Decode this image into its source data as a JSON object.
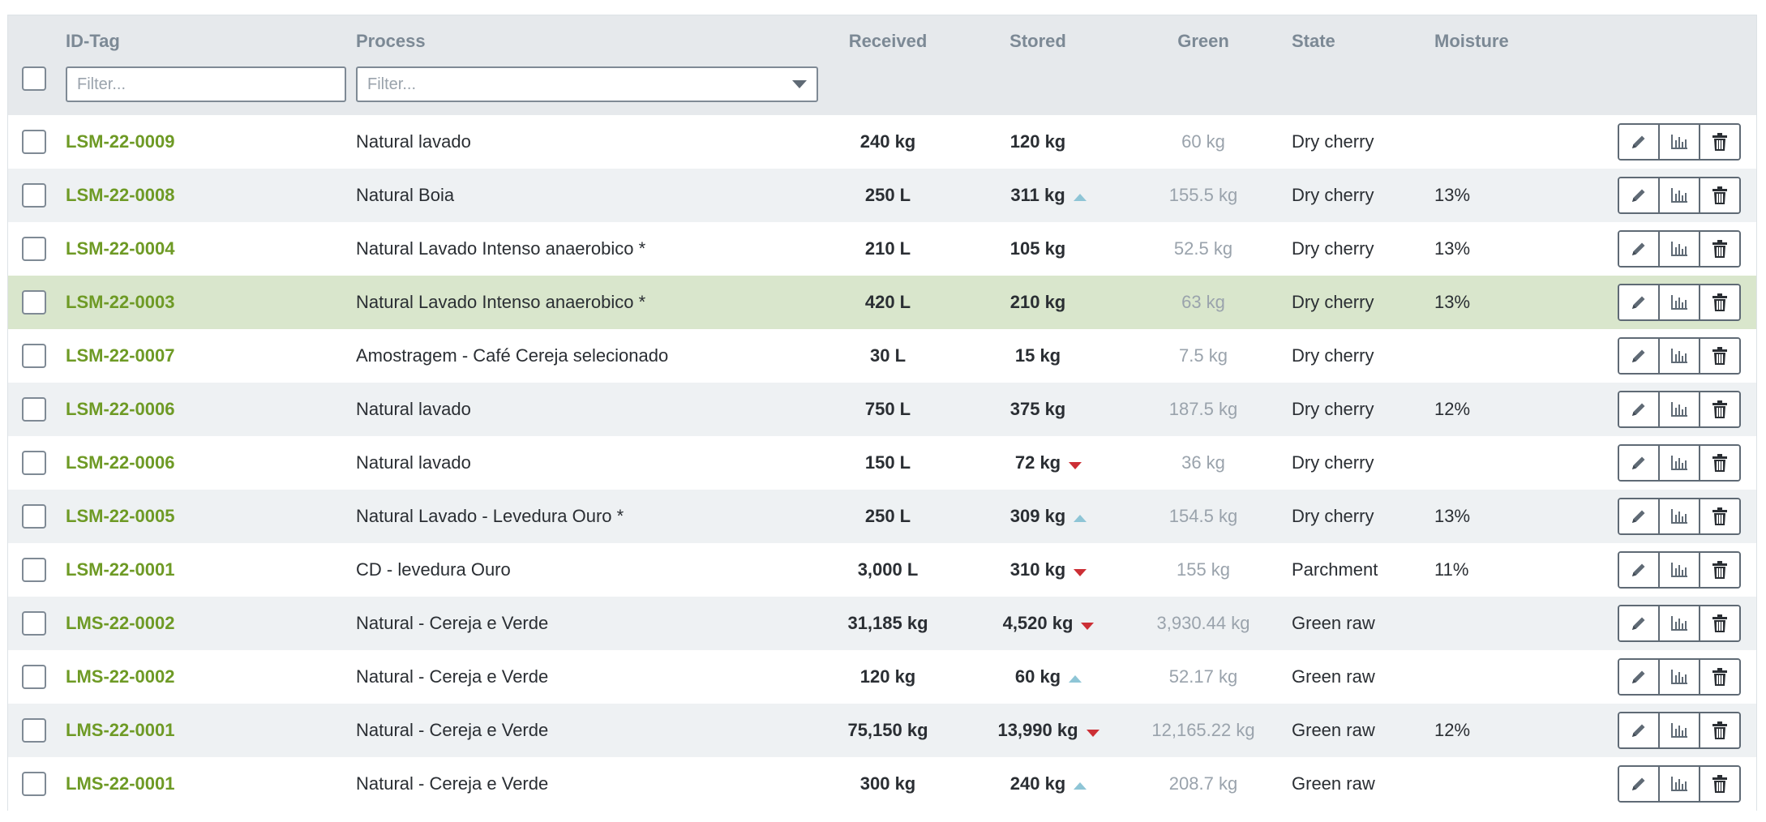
{
  "header": {
    "id_tag": "ID-Tag",
    "process": "Process",
    "received": "Received",
    "stored": "Stored",
    "green": "Green",
    "state": "State",
    "moisture": "Moisture",
    "id_filter_placeholder": "Filter...",
    "process_filter_placeholder": "Filter..."
  },
  "colors": {
    "id_green": "#6e9a25",
    "header_bg": "#e6e9ec",
    "row_alt_bg": "#eef1f3",
    "row_selected_bg": "#d9e6cc",
    "trend_up": "#8ec5d6",
    "trend_down": "#cc2f35",
    "muted_text": "#9aa3ac"
  },
  "icons": {
    "edit": "pencil-icon",
    "chart": "bar-chart-icon",
    "delete": "trash-icon",
    "trend_up": "triangle-up-icon",
    "trend_down": "triangle-down-icon",
    "dropdown": "chevron-down-icon"
  },
  "rows": [
    {
      "id": "LSM-22-0009",
      "process": "Natural lavado",
      "received": "240 kg",
      "stored": "120 kg",
      "trend": "",
      "green": "60 kg",
      "state": "Dry cherry",
      "moisture": "",
      "selected": false
    },
    {
      "id": "LSM-22-0008",
      "process": "Natural Boia",
      "received": "250 L",
      "stored": "311 kg",
      "trend": "up",
      "green": "155.5 kg",
      "state": "Dry cherry",
      "moisture": "13%",
      "selected": false
    },
    {
      "id": "LSM-22-0004",
      "process": "Natural Lavado Intenso anaerobico *",
      "received": "210 L",
      "stored": "105 kg",
      "trend": "",
      "green": "52.5 kg",
      "state": "Dry cherry",
      "moisture": "13%",
      "selected": false
    },
    {
      "id": "LSM-22-0003",
      "process": "Natural Lavado Intenso anaerobico *",
      "received": "420 L",
      "stored": "210 kg",
      "trend": "",
      "green": "63 kg",
      "state": "Dry cherry",
      "moisture": "13%",
      "selected": true
    },
    {
      "id": "LSM-22-0007",
      "process": "Amostragem - Café Cereja selecionado",
      "received": "30 L",
      "stored": "15 kg",
      "trend": "",
      "green": "7.5 kg",
      "state": "Dry cherry",
      "moisture": "",
      "selected": false
    },
    {
      "id": "LSM-22-0006",
      "process": "Natural lavado",
      "received": "750 L",
      "stored": "375 kg",
      "trend": "",
      "green": "187.5 kg",
      "state": "Dry cherry",
      "moisture": "12%",
      "selected": false
    },
    {
      "id": "LSM-22-0006",
      "process": "Natural lavado",
      "received": "150 L",
      "stored": "72 kg",
      "trend": "down",
      "green": "36 kg",
      "state": "Dry cherry",
      "moisture": "",
      "selected": false
    },
    {
      "id": "LSM-22-0005",
      "process": "Natural Lavado - Levedura Ouro *",
      "received": "250 L",
      "stored": "309 kg",
      "trend": "up",
      "green": "154.5 kg",
      "state": "Dry cherry",
      "moisture": "13%",
      "selected": false
    },
    {
      "id": "LSM-22-0001",
      "process": "CD - levedura Ouro",
      "received": "3,000 L",
      "stored": "310 kg",
      "trend": "down",
      "green": "155 kg",
      "state": "Parchment",
      "moisture": "11%",
      "selected": false
    },
    {
      "id": "LMS-22-0002",
      "process": "Natural - Cereja e Verde",
      "received": "31,185 kg",
      "stored": "4,520 kg",
      "trend": "down",
      "green": "3,930.44 kg",
      "state": "Green raw",
      "moisture": "",
      "selected": false
    },
    {
      "id": "LMS-22-0002",
      "process": "Natural - Cereja e Verde",
      "received": "120 kg",
      "stored": "60 kg",
      "trend": "up",
      "green": "52.17 kg",
      "state": "Green raw",
      "moisture": "",
      "selected": false
    },
    {
      "id": "LMS-22-0001",
      "process": "Natural - Cereja e Verde",
      "received": "75,150 kg",
      "stored": "13,990 kg",
      "trend": "down",
      "green": "12,165.22 kg",
      "state": "Green raw",
      "moisture": "12%",
      "selected": false
    },
    {
      "id": "LMS-22-0001",
      "process": "Natural - Cereja e Verde",
      "received": "300 kg",
      "stored": "240 kg",
      "trend": "up",
      "green": "208.7 kg",
      "state": "Green raw",
      "moisture": "",
      "selected": false
    }
  ]
}
